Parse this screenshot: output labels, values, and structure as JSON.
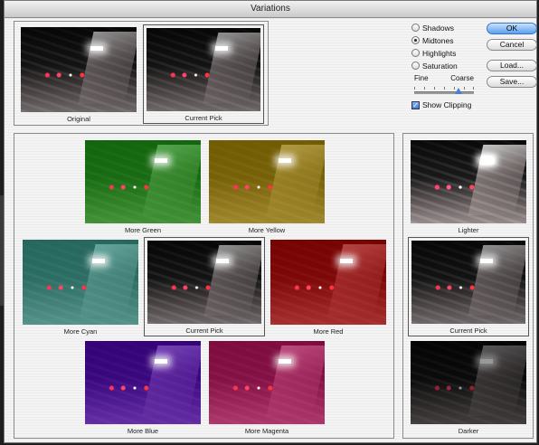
{
  "window": {
    "title": "Variations"
  },
  "current_preview": {
    "original": {
      "label": "Original"
    },
    "current": {
      "label": "Current Pick"
    }
  },
  "color_variations": [
    {
      "label": "More Green",
      "tint": "#1fb414"
    },
    {
      "label": "More Yellow",
      "tint": "#c9a300"
    },
    {
      "label": "More Cyan",
      "tint": "#3fb6a6"
    },
    {
      "label": "Current Pick",
      "tint": "#000000"
    },
    {
      "label": "More Red",
      "tint": "#d40000"
    },
    {
      "label": "More Blue",
      "tint": "#5b00d6"
    },
    {
      "label": "More Magenta",
      "tint": "#e0106e"
    }
  ],
  "brightness_variations": [
    {
      "label": "Lighter"
    },
    {
      "label": "Current Pick"
    },
    {
      "label": "Darker"
    }
  ],
  "tone_options": [
    {
      "label": "Shadows",
      "selected": false
    },
    {
      "label": "Midtones",
      "selected": true
    },
    {
      "label": "Highlights",
      "selected": false
    },
    {
      "label": "Saturation",
      "selected": false
    }
  ],
  "slider": {
    "left_label": "Fine",
    "right_label": "Coarse",
    "value_fraction": 0.7
  },
  "show_clipping": {
    "label": "Show Clipping",
    "checked": true
  },
  "buttons": {
    "ok": "OK",
    "cancel": "Cancel",
    "load": "Load...",
    "save": "Save..."
  }
}
